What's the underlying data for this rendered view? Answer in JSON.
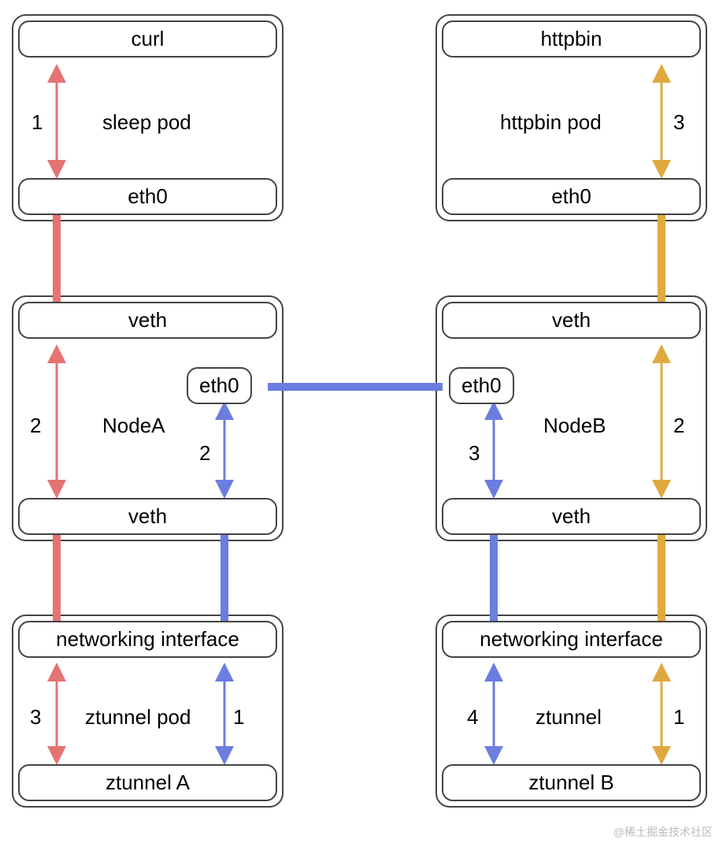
{
  "colors": {
    "red": "#e57373",
    "blue": "#6c7de0",
    "gold": "#e0a940",
    "border": "#444444"
  },
  "left": {
    "pod": {
      "top": "curl",
      "bottom": "eth0",
      "label": "sleep pod",
      "arrow_num": "1"
    },
    "node": {
      "top": "veth",
      "bottom": "veth",
      "label": "NodeA",
      "eth": "eth0",
      "arrow_left_num": "2",
      "arrow_right_num": "2"
    },
    "zt": {
      "top": "networking interface",
      "bottom": "ztunnel A",
      "label": "ztunnel pod",
      "arrow_left_num": "3",
      "arrow_right_num": "1"
    }
  },
  "right": {
    "pod": {
      "top": "httpbin",
      "bottom": "eth0",
      "label": "httpbin pod",
      "arrow_num": "3"
    },
    "node": {
      "top": "veth",
      "bottom": "veth",
      "label": "NodeB",
      "eth": "eth0",
      "arrow_left_num": "3",
      "arrow_right_num": "2"
    },
    "zt": {
      "top": "networking interface",
      "bottom": "ztunnel B",
      "label": "ztunnel",
      "arrow_left_num": "4",
      "arrow_right_num": "1"
    }
  },
  "watermark": "@稀土掘金技术社区"
}
